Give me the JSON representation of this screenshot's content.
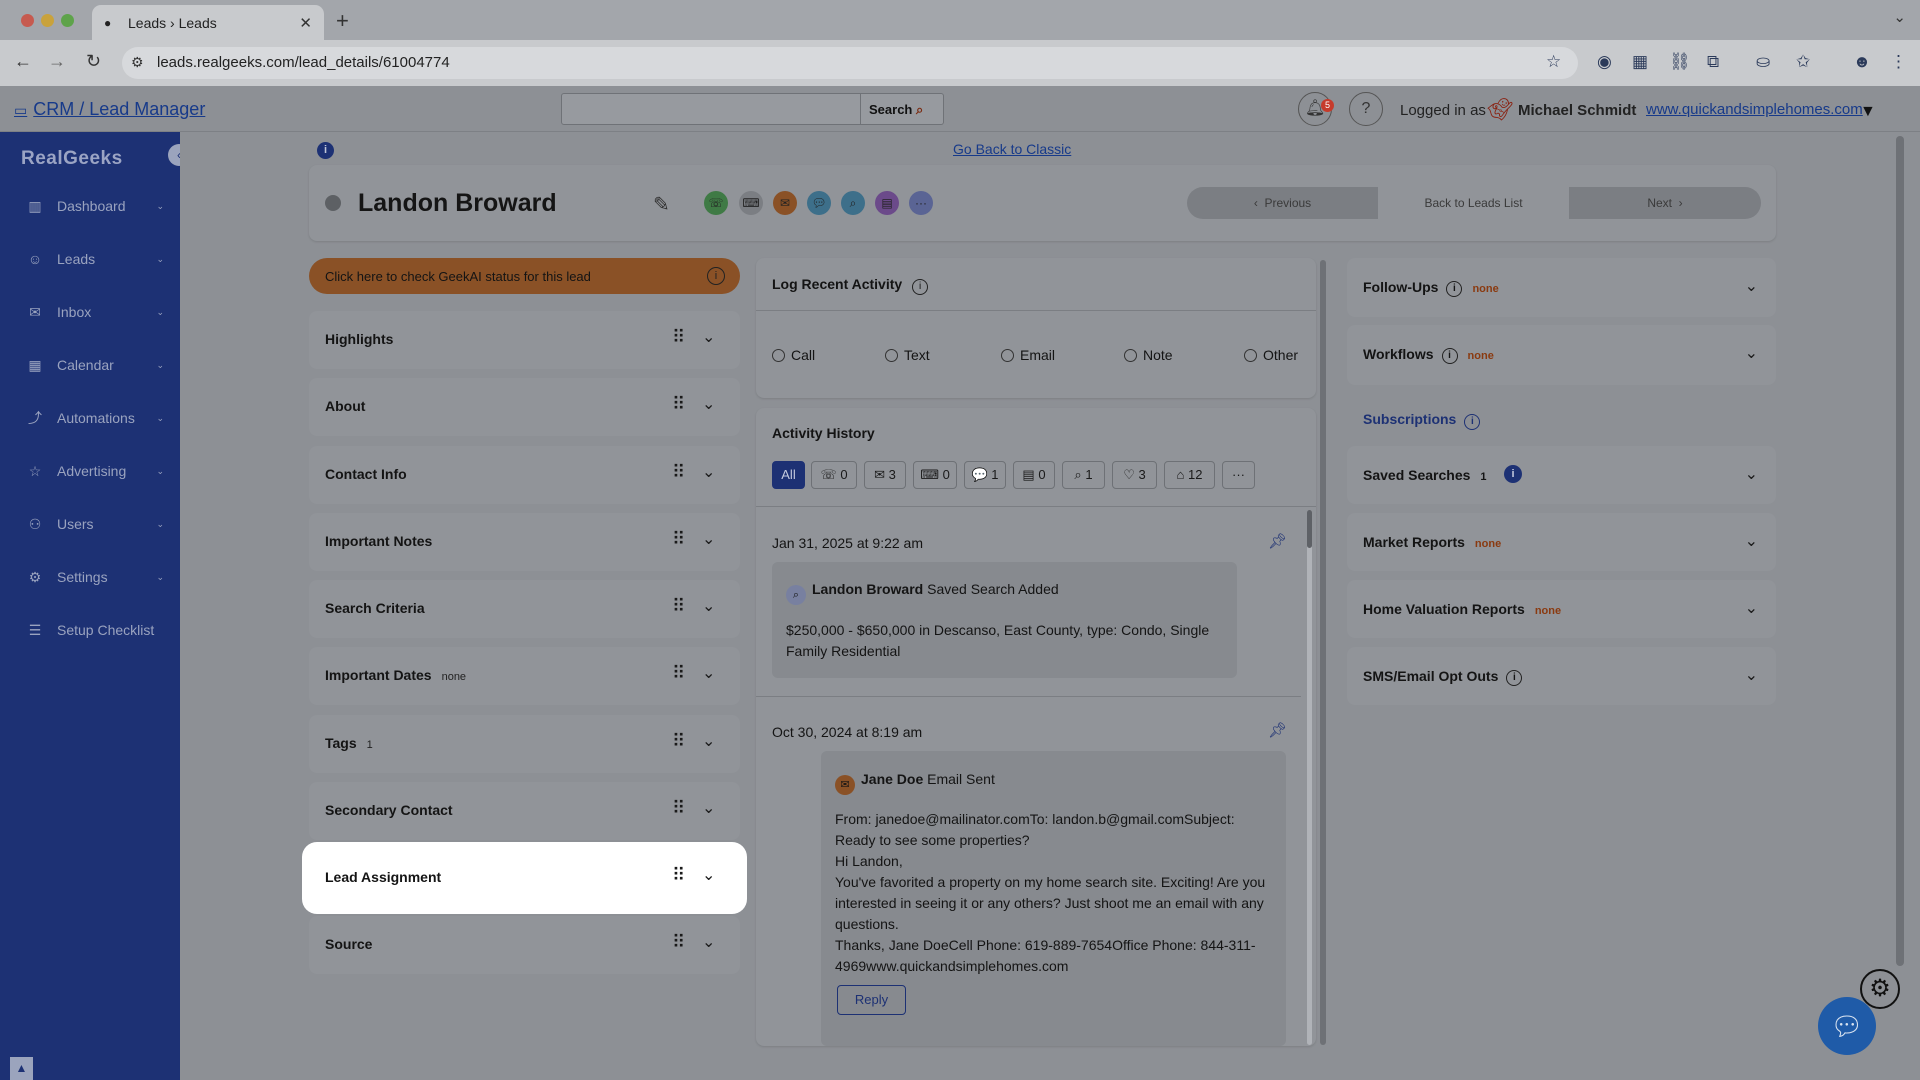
{
  "browser": {
    "tab_title": "Leads › Leads",
    "url": "leads.realgeeks.com/lead_details/61004774",
    "traffic_colors": [
      "#c65a4f",
      "#c9a23c",
      "#5ea34a"
    ]
  },
  "header": {
    "app_title": "CRM / Lead Manager",
    "search_placeholder": "",
    "search_label": "Search",
    "notification_count": "5",
    "logged_in_label": "Logged in as",
    "user_name": "Michael Schmidt",
    "site_link": "www.quickandsimplehomes.com"
  },
  "sidebar": {
    "logo": "RealGeeks",
    "items": [
      {
        "label": "Dashboard",
        "icon": "chart-icon",
        "glyph": "▥",
        "caret": "⌄"
      },
      {
        "label": "Leads",
        "icon": "users-icon",
        "glyph": "☺",
        "caret": "⌄"
      },
      {
        "label": "Inbox",
        "icon": "mail-icon",
        "glyph": "✉",
        "caret": "⌄"
      },
      {
        "label": "Calendar",
        "icon": "calendar-icon",
        "glyph": "▦",
        "caret": "⌄"
      },
      {
        "label": "Automations",
        "icon": "automation-icon",
        "glyph": "⤴",
        "caret": "⌄"
      },
      {
        "label": "Advertising",
        "icon": "star-icon",
        "glyph": "☆",
        "caret": "⌄"
      },
      {
        "label": "Users",
        "icon": "user-icon",
        "glyph": "⚇",
        "caret": "⌄"
      },
      {
        "label": "Settings",
        "icon": "gear-icon",
        "glyph": "⚙",
        "caret": "⌄"
      },
      {
        "label": "Setup Checklist",
        "icon": "checklist-icon",
        "glyph": "☰",
        "caret": ""
      }
    ]
  },
  "lead": {
    "back_classic": "Go Back to Classic",
    "name": "Landon Broward",
    "pager": {
      "previous": "Previous",
      "back": "Back to Leads List",
      "next": "Next"
    },
    "geekai": "Click here to check GeekAI status for this lead"
  },
  "left_cards": [
    {
      "title": "Highlights",
      "badge": ""
    },
    {
      "title": "About",
      "badge": ""
    },
    {
      "title": "Contact Info",
      "badge": ""
    },
    {
      "title": "Important Notes",
      "badge": ""
    },
    {
      "title": "Search Criteria",
      "badge": ""
    },
    {
      "title": "Important Dates",
      "badge": "none"
    },
    {
      "title": "Tags",
      "badge": "1"
    },
    {
      "title": "Secondary Contact",
      "badge": ""
    },
    {
      "title": "Lead Assignment",
      "badge": ""
    },
    {
      "title": "Source",
      "badge": ""
    }
  ],
  "activity": {
    "log_title": "Log Recent Activity",
    "types": [
      "Call",
      "Text",
      "Email",
      "Note",
      "Other"
    ],
    "history_title": "Activity History",
    "filters": [
      {
        "icon": "",
        "label": "All"
      },
      {
        "icon": "☏",
        "label": "0"
      },
      {
        "icon": "✉",
        "label": "3"
      },
      {
        "icon": "⌨",
        "label": "0"
      },
      {
        "icon": "💬",
        "label": "1"
      },
      {
        "icon": "▤",
        "label": "0"
      },
      {
        "icon": "⌕",
        "label": "1"
      },
      {
        "icon": "♡",
        "label": "3"
      },
      {
        "icon": "⌂",
        "label": "12"
      },
      {
        "icon": "",
        "label": "···"
      }
    ],
    "entries": [
      {
        "date": "Jan 31, 2025 at 9:22 am",
        "who": "Landon Broward",
        "action": "Saved Search Added",
        "body": "$250,000 - $650,000 in Descanso, East County, type: Condo, Single Family Residential"
      },
      {
        "date": "Oct 30, 2024 at 8:19 am",
        "who": "Jane Doe",
        "action": "Email Sent",
        "body_lines": [
          "From: janedoe@mailinator.comTo: landon.b@gmail.comSubject: Ready to see some properties?",
          "Hi Landon,",
          "You've favorited a property on my home search site. Exciting! Are you interested in seeing it or any others? Just shoot me an email with any questions.",
          "Thanks, Jane DoeCell Phone: 619-889-7654Office Phone: 844-311-4969www.quickandsimplehomes.com"
        ],
        "reply": "Reply"
      }
    ]
  },
  "right_cards": {
    "followups": {
      "title": "Follow-Ups",
      "badge": "none"
    },
    "workflows": {
      "title": "Workflows",
      "badge": "none"
    },
    "subscriptions": "Subscriptions",
    "saved": {
      "title": "Saved Searches",
      "badge": "1"
    },
    "market": {
      "title": "Market Reports",
      "badge": "none"
    },
    "valuation": {
      "title": "Home Valuation Reports",
      "badge": "none"
    },
    "optouts": {
      "title": "SMS/Email Opt Outs",
      "badge": ""
    }
  }
}
